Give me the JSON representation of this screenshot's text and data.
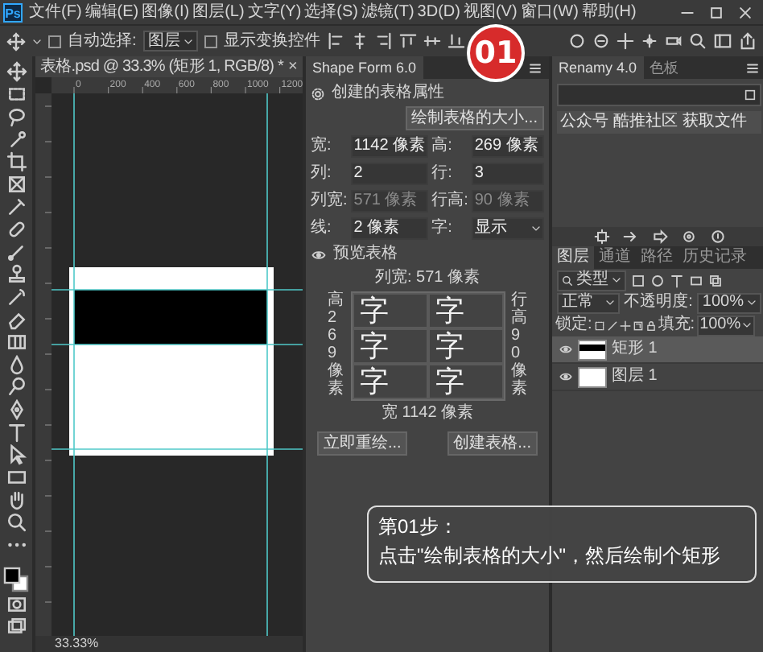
{
  "menu_bar": {
    "logo": "Ps",
    "items": [
      "文件(F)",
      "编辑(E)",
      "图像(I)",
      "图层(L)",
      "文字(Y)",
      "选择(S)",
      "滤镜(T)",
      "3D(D)",
      "视图(V)",
      "窗口(W)",
      "帮助(H)"
    ]
  },
  "options_bar": {
    "auto_select": {
      "label": "自动选择:",
      "checked": false
    },
    "target": "图层",
    "show_transform": {
      "label": "显示变换控件",
      "checked": false
    }
  },
  "document": {
    "tab_title": "表格.psd @ 33.3% (矩形 1, RGB/8) *",
    "close": "×",
    "ruler_labels": [
      "0",
      "200",
      "400",
      "600",
      "800",
      "1000",
      "1200"
    ],
    "zoom": "33.33%"
  },
  "shape_form_panel": {
    "title": "Shape Form 6.0",
    "section": "创建的表格属性",
    "draw_button": "绘制表格的大小...",
    "fields": [
      {
        "label": "宽:",
        "value": "1142 像素",
        "kind": "input",
        "disabled": false
      },
      {
        "label": "高:",
        "value": "269 像素",
        "kind": "input",
        "disabled": false
      },
      {
        "label": "列:",
        "value": "2",
        "kind": "input",
        "disabled": false
      },
      {
        "label": "行:",
        "value": "3",
        "kind": "input",
        "disabled": false
      },
      {
        "label": "列宽:",
        "value": "571 像素",
        "kind": "input",
        "disabled": true
      },
      {
        "label": "行高:",
        "value": "90 像素",
        "kind": "input",
        "disabled": true
      },
      {
        "label": "线:",
        "value": "2 像素",
        "kind": "input",
        "disabled": false
      },
      {
        "label": "字:",
        "value": "显示",
        "kind": "select",
        "disabled": false
      }
    ],
    "preview_toggle": "预览表格",
    "preview": {
      "column_width": "列宽: 571 像素",
      "height": "高269像素",
      "row_height": "行高90像素",
      "width": "宽 1142 像素",
      "cells": [
        "字",
        "字",
        "字",
        "字",
        "字",
        "字"
      ]
    },
    "buttons": [
      "立即重绘...",
      "创建表格..."
    ]
  },
  "renamy_panel": {
    "tabs": [
      {
        "label": "Renamy 4.0",
        "selected": true
      },
      {
        "label": "色板",
        "selected": false
      }
    ],
    "links": [
      "公众号",
      "酷推社区",
      "获取文件"
    ]
  },
  "layers_panel": {
    "tabs": [
      {
        "label": "图层",
        "selected": true
      },
      {
        "label": "通道",
        "selected": false
      },
      {
        "label": "路径",
        "selected": false
      },
      {
        "label": "历史记录",
        "selected": false
      }
    ],
    "filter": "类型",
    "blend_mode": "正常",
    "opacity_label": "不透明度:",
    "opacity": "100%",
    "lock_label": "锁定:",
    "fill_label": "填充:",
    "fill": "100%",
    "layers": [
      {
        "name": "矩形 1",
        "kind": "shape",
        "selected": true,
        "visible": true
      },
      {
        "name": "图层 1",
        "kind": "fill",
        "selected": false,
        "visible": true
      }
    ]
  },
  "caption": {
    "badge": "01",
    "step": "第01步：",
    "text": "点击\"绘制表格的大小\"，然后绘制个矩形"
  }
}
